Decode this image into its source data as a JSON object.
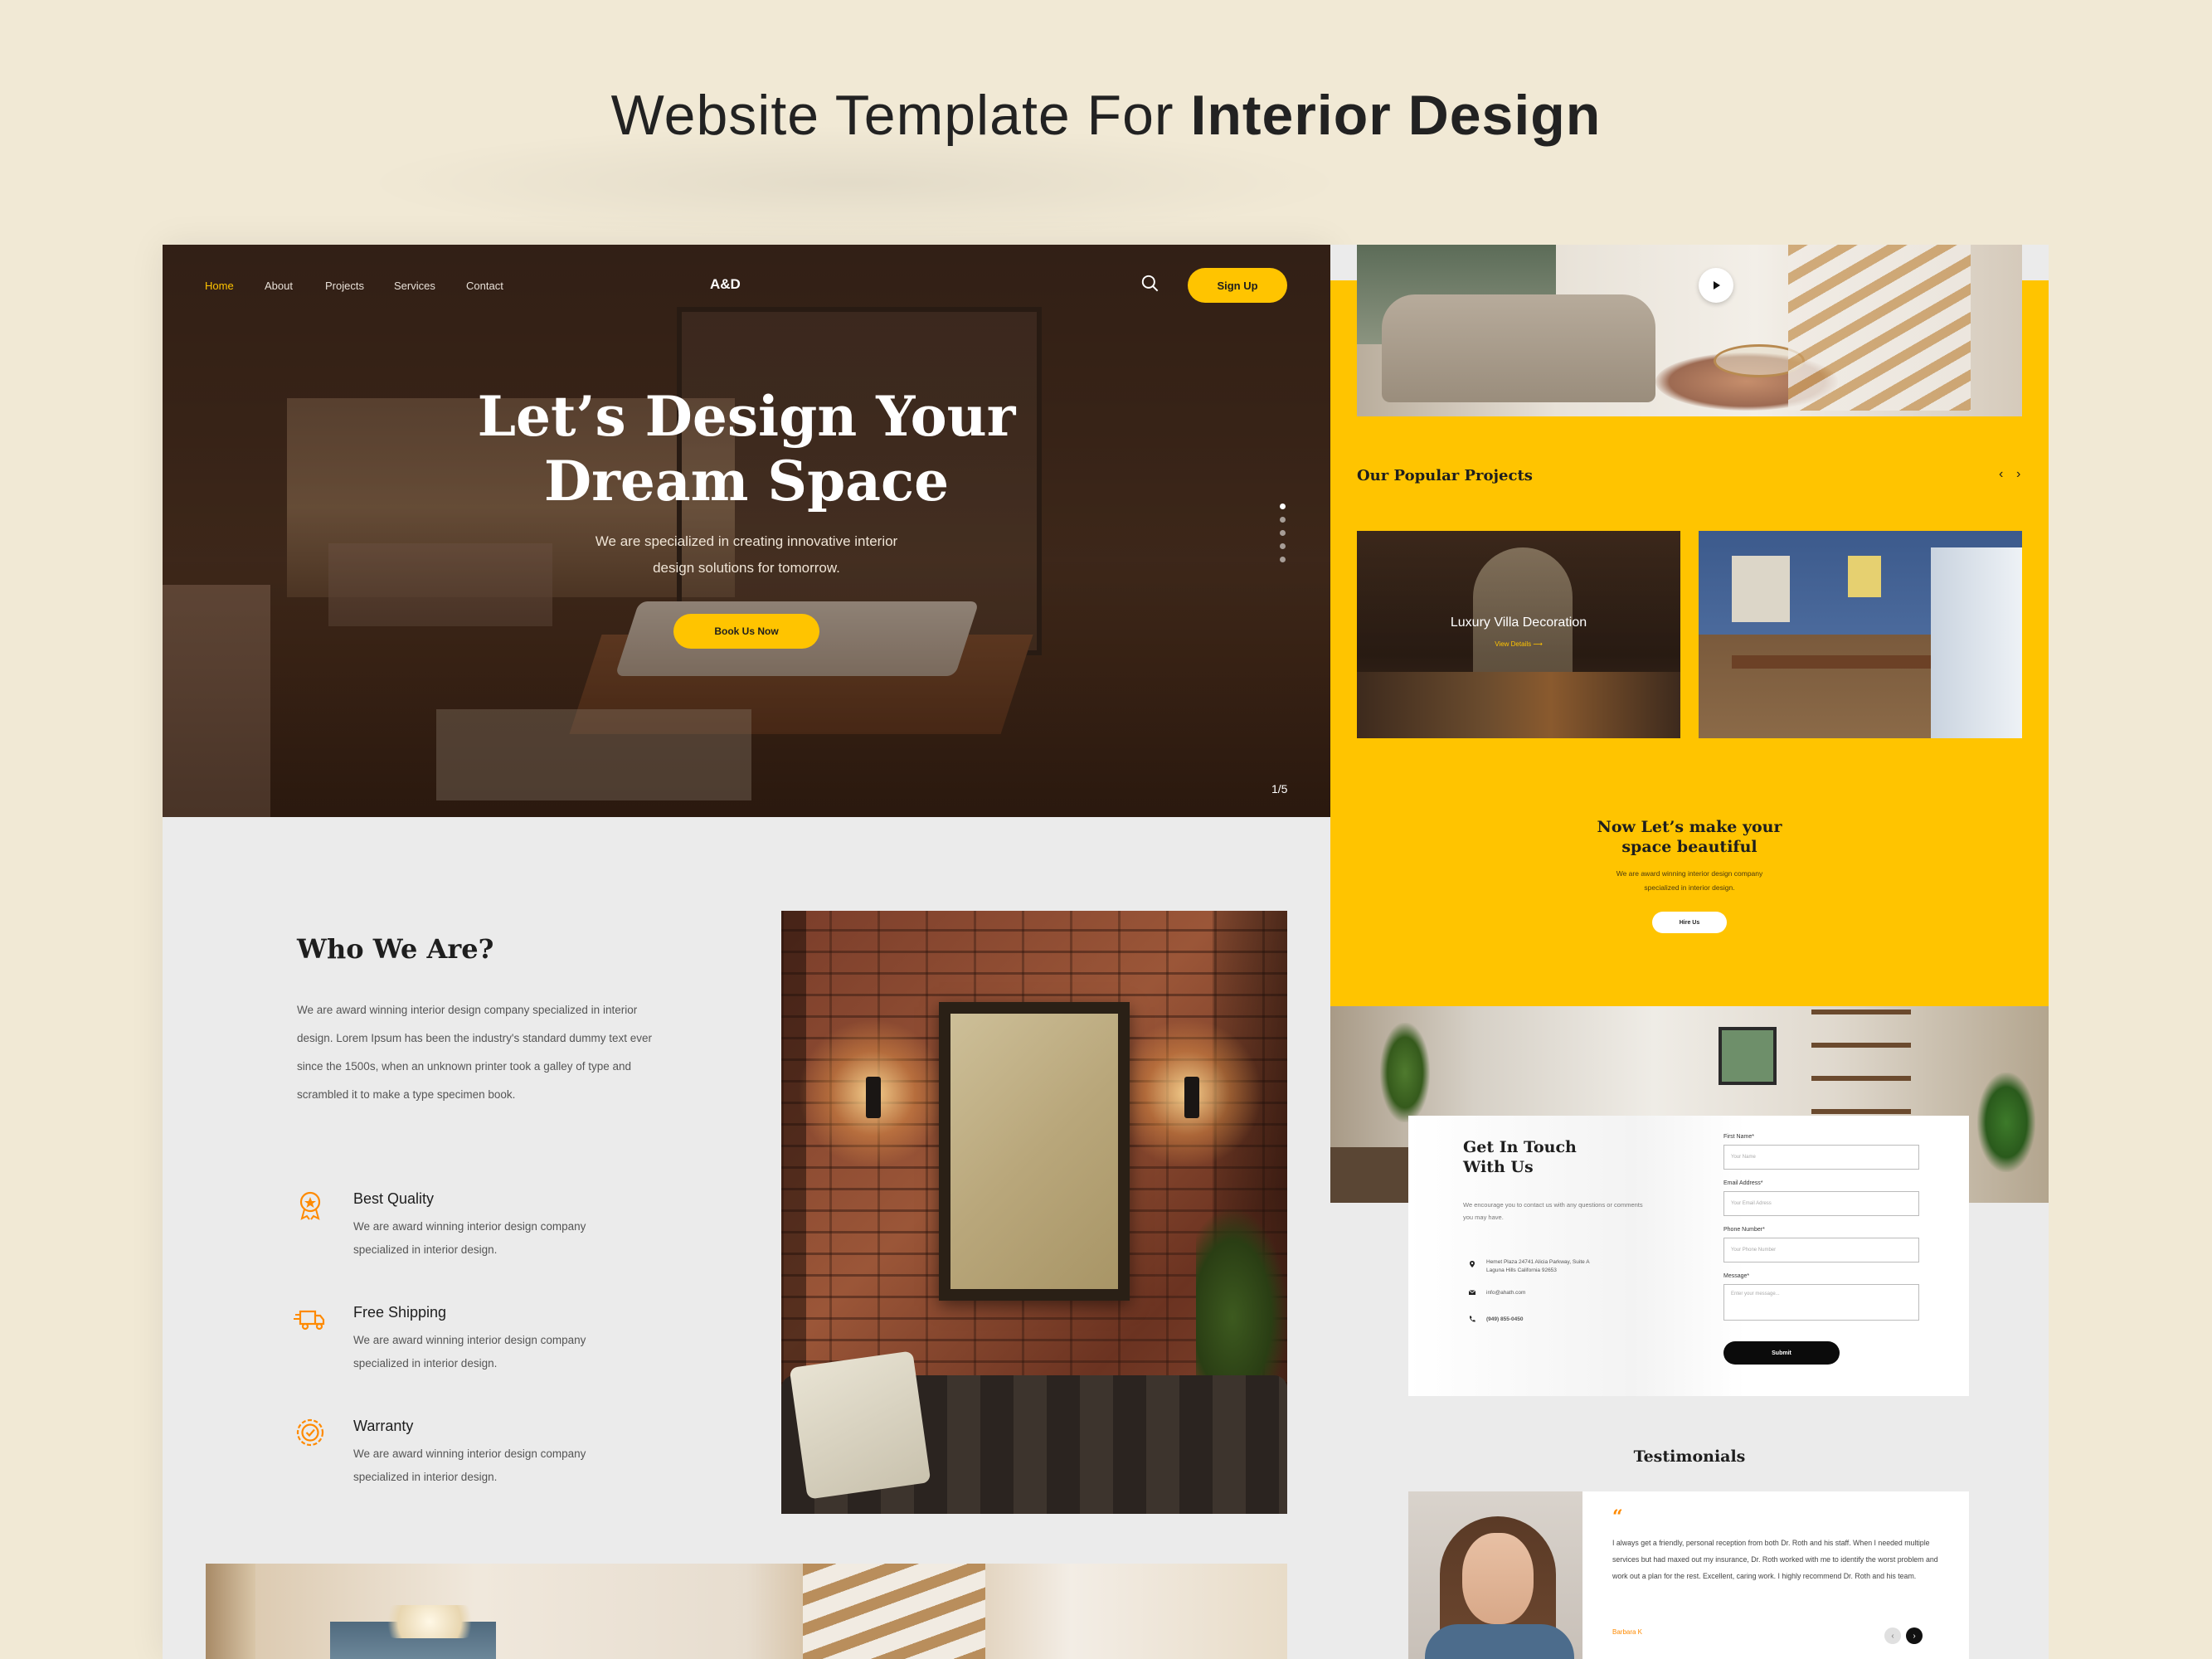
{
  "showcase": {
    "title_regular": "Website Template For ",
    "title_bold": "Interior Design"
  },
  "hero": {
    "nav": [
      "Home",
      "About",
      "Projects",
      "Services",
      "Contact"
    ],
    "logo": "A&D",
    "signup_label": "Sign Up",
    "heading_line1": "Let’s Design Your",
    "heading_line2": "Dream Space",
    "sub_line1": "We are specialized in creating innovative interior",
    "sub_line2": "design solutions for tomorrow.",
    "cta_label": "Book Us Now",
    "slide_counter": "1/5",
    "accent": "#ffc400"
  },
  "about": {
    "heading": "Who We Are?",
    "para_lines": [
      "We are award winning interior design company specialized in interior",
      "design. Lorem Ipsum has been the industry's standard dummy text ever",
      "since the 1500s, when an unknown printer took a galley of type and",
      "scrambled it to make a type specimen book."
    ],
    "features": [
      {
        "icon": "award-badge-icon",
        "title": "Best Quality",
        "desc1": "We are award winning interior design company",
        "desc2": "specialized in interior design."
      },
      {
        "icon": "delivery-truck-icon",
        "title": "Free Shipping",
        "desc1": "We are award winning interior design company",
        "desc2": "specialized in interior design."
      },
      {
        "icon": "warranty-gear-icon",
        "title": "Warranty",
        "desc1": "We are award winning interior design company",
        "desc2": "specialized in interior design."
      }
    ],
    "icon_color": "#ff8a00"
  },
  "projects": {
    "heading": "Our Popular Projects",
    "prev": "‹",
    "next": "›",
    "card1_title": "Luxury Villa Decoration",
    "card1_link": "View Details ⟶"
  },
  "cta": {
    "line1": "Now Let’s make your",
    "line2": "space beautiful",
    "desc1": "We are award winning interior design company",
    "desc2": "specialized in interior design.",
    "button": "Hire Us"
  },
  "contact": {
    "heading_line1": "Get In Touch",
    "heading_line2": "With Us",
    "desc": "We encourage you to contact us with any questions or comments you may have.",
    "address_line1": "Hemet Plaza 24741 Alicia Parkway, Suite A",
    "address_line2": "Laguna Hills California 92653",
    "email": "info@ahath.com",
    "phone": "(949) 855-0450",
    "fields": [
      {
        "label": "First Name*",
        "placeholder": "Your Name"
      },
      {
        "label": "Email Address*",
        "placeholder": "Your Email Adress"
      },
      {
        "label": "Phone Number*",
        "placeholder": "Your Phone Number"
      },
      {
        "label": "Message*",
        "placeholder": "Enter your message..."
      }
    ],
    "submit": "Submit"
  },
  "testimonials": {
    "heading": "Testimonials",
    "quote_mark": "“",
    "text": "I always get a friendly, personal reception from both Dr. Roth and his staff. When I needed multiple services but had maxed out my insurance, Dr. Roth worked with me to identify the worst problem and work out a plan for the rest. Excellent, caring work. I highly recommend Dr. Roth and his team.",
    "name": "Barbara K",
    "prev": "‹",
    "next": "›"
  }
}
